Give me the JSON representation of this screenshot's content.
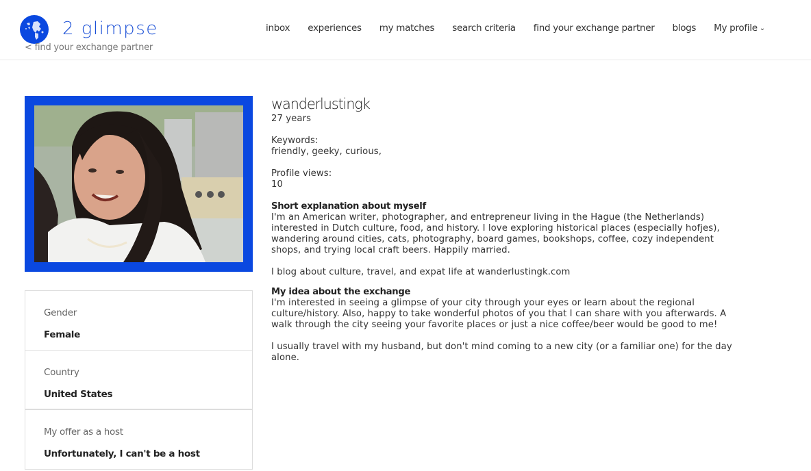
{
  "header": {
    "logo_text": "2 glimpse",
    "logo_icon": "globe-icon",
    "back_link": "< find your exchange partner",
    "nav": [
      {
        "label": "inbox"
      },
      {
        "label": "experiences"
      },
      {
        "label": "my matches"
      },
      {
        "label": "search criteria"
      },
      {
        "label": "find your exchange partner"
      },
      {
        "label": "blogs"
      },
      {
        "label": "My profile",
        "icon": "chevron-down-icon"
      }
    ]
  },
  "colors": {
    "brand_blue": "#0a48e0",
    "logo_text_blue": "#1a4fd6",
    "border": "#dddddd"
  },
  "profile": {
    "photo": "profile-photo",
    "username": "wanderlustingk",
    "age": "27 years",
    "keywords_label": "Keywords:",
    "keywords": "friendly, geeky, curious,",
    "views_label": "Profile views:",
    "views": "10",
    "about_title": "Short explanation about myself",
    "about_text": "I'm an American writer, photographer, and entrepreneur living in the Hague (the Netherlands) interested in Dutch culture, food, and history. I love exploring historical places (especially hofjes), wandering around cities, cats, photography, board games, bookshops, coffee, cozy independent shops, and trying local craft beers. Happily married.",
    "about_text_2": "I blog about culture, travel, and expat life at wanderlustingk.com",
    "exchange_title": "My idea about the exchange",
    "exchange_text": "I'm interested in seeing a glimpse of your city through your eyes or learn about the regional culture/history. Also, happy to take wonderful photos of you that I can share with you afterwards. A walk through the city seeing your favorite places or just a nice coffee/beer would be good to me!",
    "exchange_text_2": "I usually travel with my husband, but don't mind coming to a new city (or a familiar one) for the day alone."
  },
  "details": [
    {
      "label": "Gender",
      "value": "Female"
    },
    {
      "label": "Country",
      "value": "United States"
    },
    {
      "label": "My offer as a host",
      "value": "Unfortunately, I can't be a host"
    }
  ]
}
